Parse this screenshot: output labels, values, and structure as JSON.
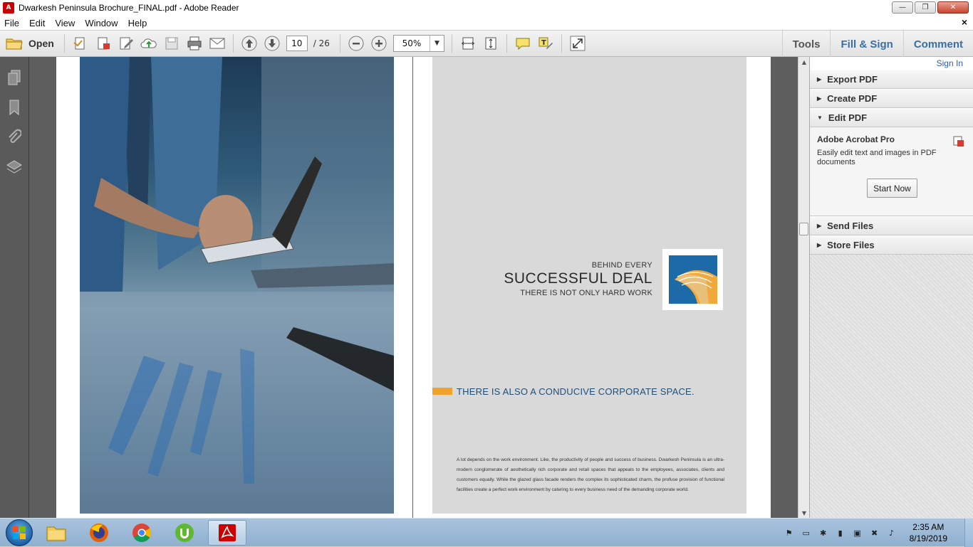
{
  "window": {
    "title": "Dwarkesh Peninsula Brochure_FINAL.pdf - Adobe Reader",
    "minimize": "—",
    "restore": "❐",
    "close": "✕"
  },
  "menu": {
    "items": [
      "File",
      "Edit",
      "View",
      "Window",
      "Help"
    ],
    "doc_close": "×"
  },
  "toolbar": {
    "open_label": "Open",
    "current_page": "10",
    "total_pages": "/ 26",
    "zoom": "50%",
    "zoom_dropdown": "▼",
    "tools_label": "Tools",
    "fill_sign_label": "Fill & Sign",
    "comment_label": "Comment"
  },
  "document": {
    "headline_small": "BEHIND EVERY",
    "headline_big": "SUCCESSFUL DEAL",
    "headline_sub": "THERE IS NOT ONLY HARD WORK",
    "space_heading": "THERE IS ALSO A CONDUCIVE CORPORATE SPACE.",
    "body_text": "A lot depends on the work environment. Like, the productivity of people and success of business. Dwarkesh Peninsula is an ultra-modern conglomerate of aesthetically rich corporate and retail spaces that appeals to the employees, associates, clients and customers equally. While the glazed glass facade renders the complex its sophisticated charm, the profuse provision of functional facilities create a perfect work environment by catering to every business need of the demanding corporate world."
  },
  "right_panel": {
    "sign_in": "Sign In",
    "sections": {
      "export_pdf": "Export PDF",
      "create_pdf": "Create PDF",
      "edit_pdf": "Edit PDF",
      "send_files": "Send Files",
      "store_files": "Store Files"
    },
    "edit_pdf_content": {
      "product_title": "Adobe Acrobat Pro",
      "description": "Easily edit text and images in PDF documents",
      "button": "Start Now"
    }
  },
  "taskbar": {
    "clock_time": "2:35 AM",
    "clock_date": "8/19/2019"
  },
  "colors": {
    "accent_orange": "#f0a22c",
    "heading_blue": "#1f4f7a",
    "link_blue": "#3a6ea5",
    "page_grey": "#d9d9d9"
  }
}
